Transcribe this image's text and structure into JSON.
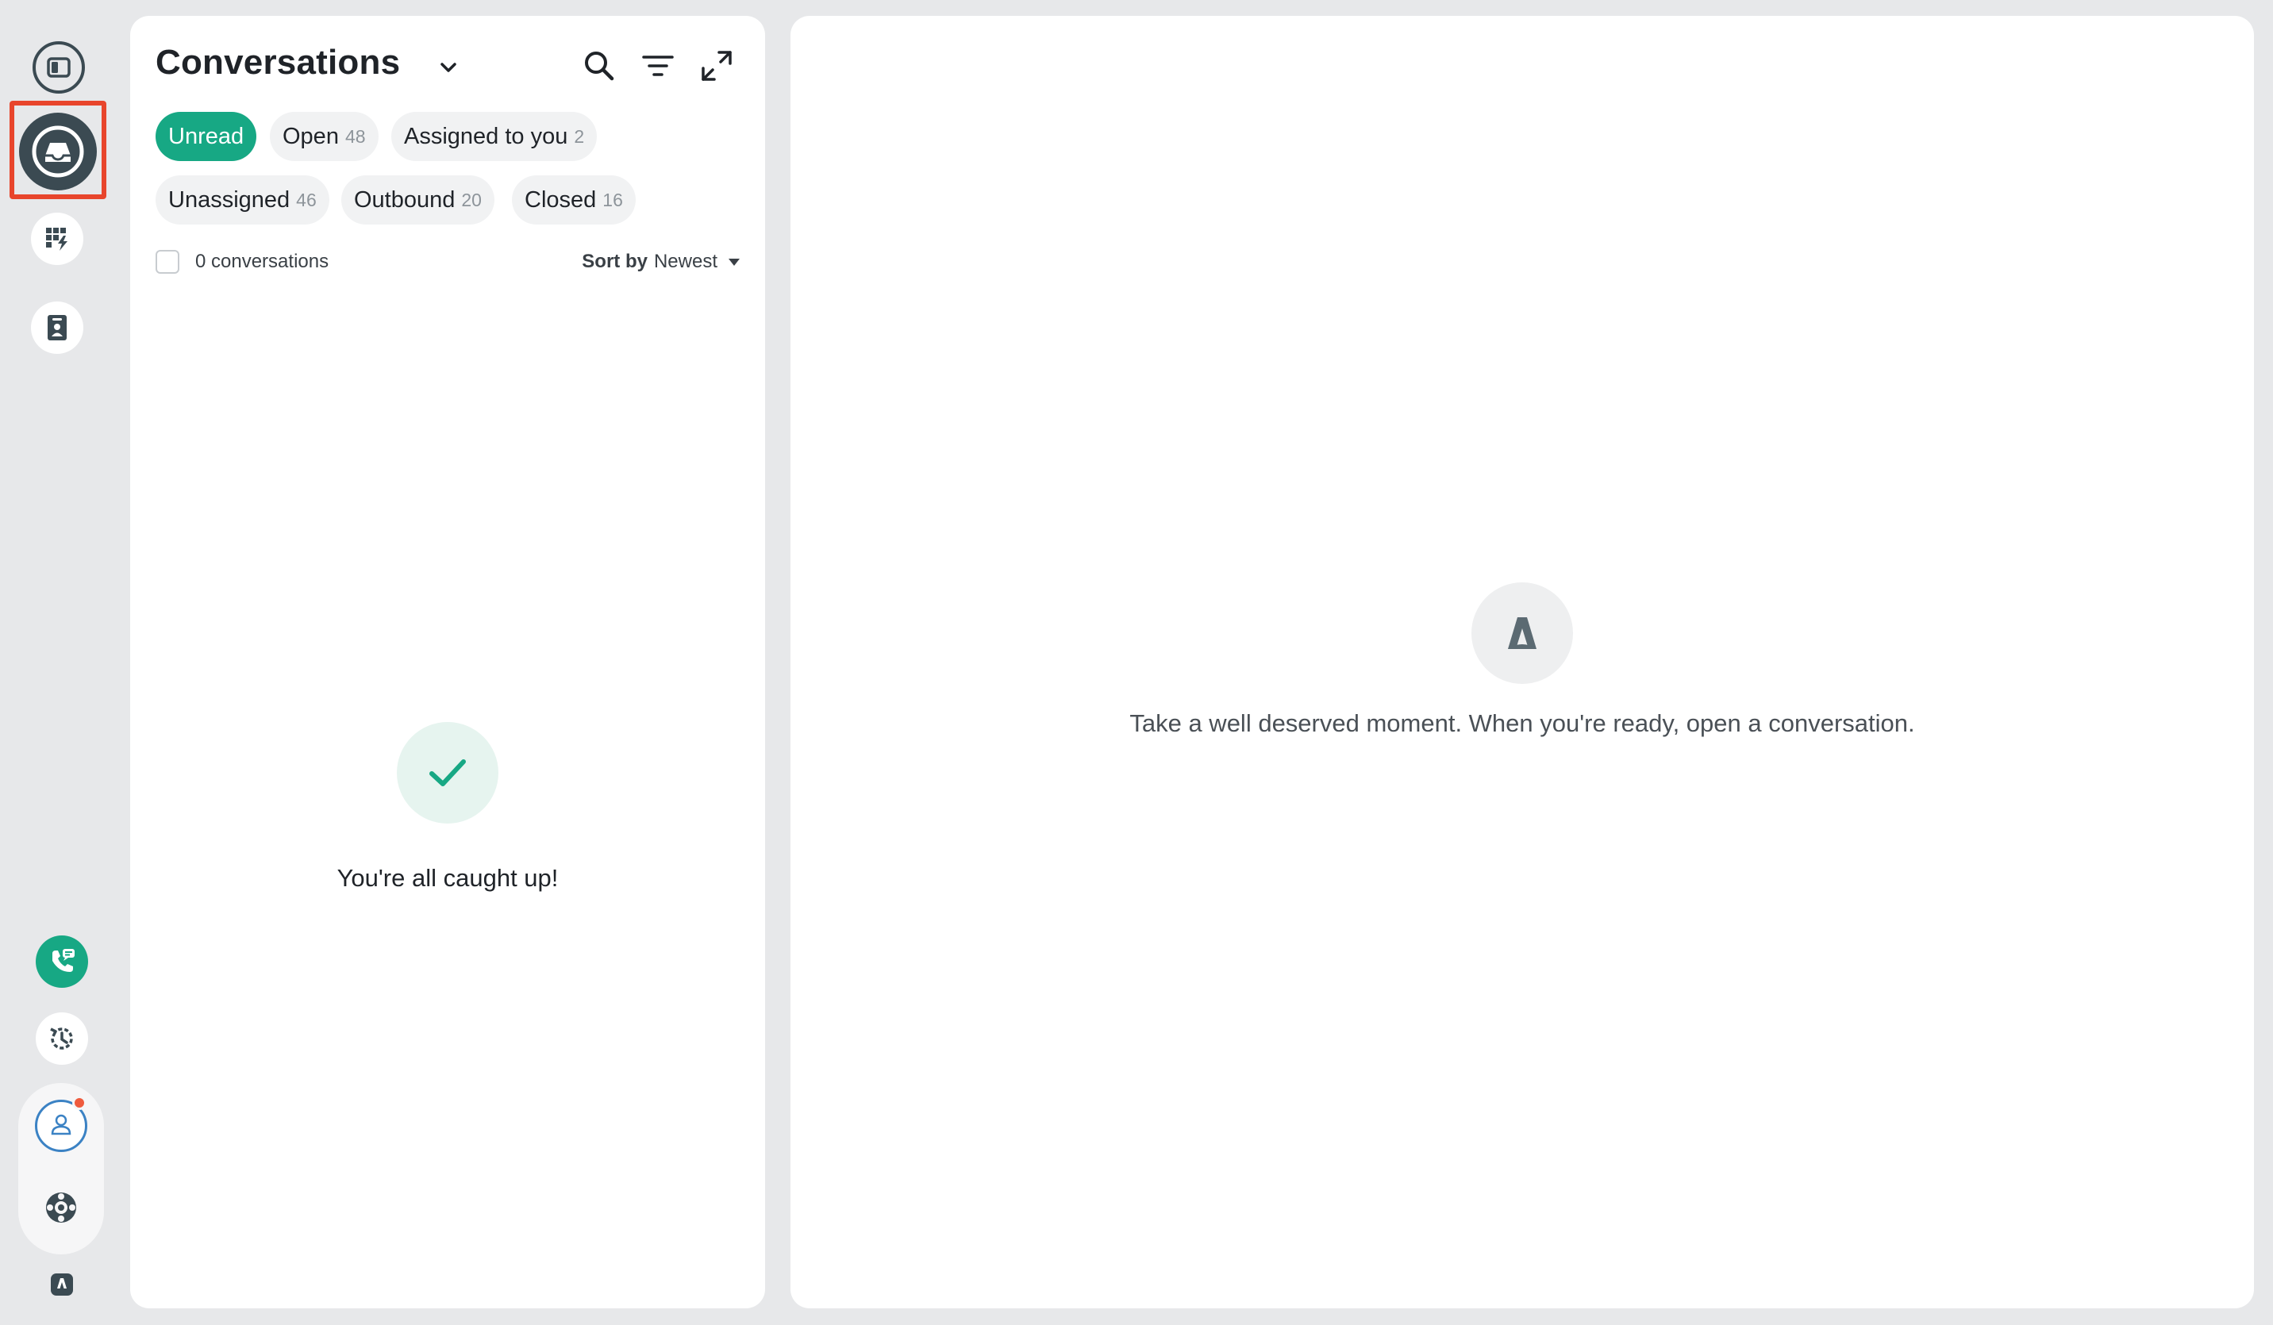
{
  "rail": {
    "items": [
      {
        "name": "sidebar-toggle",
        "icon": "sidebar-toggle-icon"
      },
      {
        "name": "inbox",
        "icon": "inbox-icon",
        "active": true
      },
      {
        "name": "workflows",
        "icon": "workflow-grid-icon"
      },
      {
        "name": "contacts",
        "icon": "contact-card-icon"
      },
      {
        "name": "phone-chat",
        "icon": "phone-chat-icon"
      },
      {
        "name": "history",
        "icon": "history-icon"
      },
      {
        "name": "profile",
        "icon": "user-avatar-icon",
        "has_notification": true
      },
      {
        "name": "help",
        "icon": "lifebuoy-icon"
      },
      {
        "name": "brand",
        "icon": "brand-logo-icon"
      }
    ]
  },
  "conversations": {
    "title": "Conversations",
    "filters": [
      {
        "label": "Unread",
        "count": "",
        "active": true
      },
      {
        "label": "Open",
        "count": "48"
      },
      {
        "label": "Assigned to you",
        "count": "2"
      },
      {
        "label": "Unassigned",
        "count": "46"
      },
      {
        "label": "Outbound",
        "count": "20"
      },
      {
        "label": "Closed",
        "count": "16"
      }
    ],
    "count_label": "0 conversations",
    "sort_label": "Sort by",
    "sort_value": "Newest",
    "empty_message": "You're all caught up!"
  },
  "detail": {
    "empty_message": "Take a well deserved moment. When you're ready, open a conversation."
  },
  "colors": {
    "accent": "#17a884",
    "rail_dark": "#3b4a52",
    "highlight": "#e8452c",
    "notification": "#ef5b3d"
  }
}
